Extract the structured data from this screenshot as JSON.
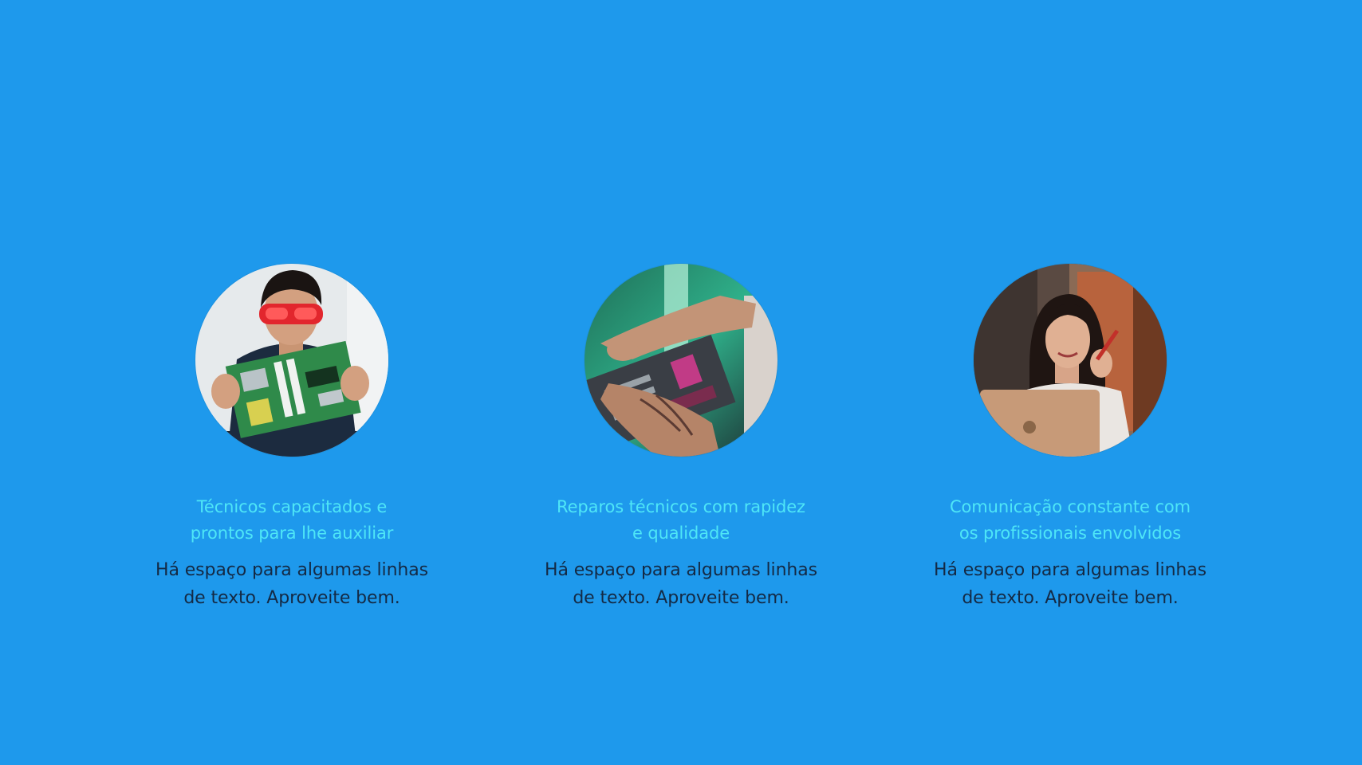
{
  "features": [
    {
      "title_line1": "Técnicos capacitados e",
      "title_line2": "prontos para lhe auxiliar",
      "text_line1": "Há espaço para algumas linhas",
      "text_line2": "de texto. Aproveite bem.",
      "photo_subject": "technician-with-motherboard"
    },
    {
      "title_line1": "Reparos técnicos com rapidez",
      "title_line2": "e qualidade",
      "text_line1": "Há espaço para algumas linhas",
      "text_line2": "de texto. Aproveite bem.",
      "photo_subject": "hands-repairing-circuit-board"
    },
    {
      "title_line1": "Comunicação constante com",
      "title_line2": "os profissionais envolvidos",
      "text_line1": "Há espaço para algumas linhas",
      "text_line2": "de texto. Aproveite bem.",
      "photo_subject": "woman-with-laptop"
    }
  ],
  "colors": {
    "background": "#1e99ec",
    "title": "#4ee6f7",
    "body_text": "#142a45"
  }
}
